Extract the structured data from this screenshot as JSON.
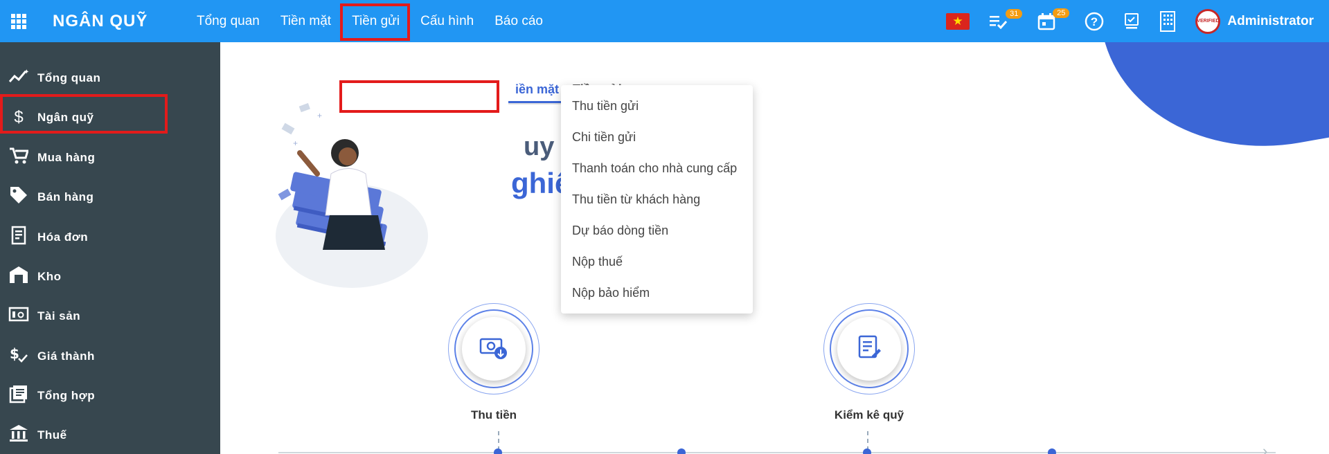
{
  "app": {
    "brand": "NGÂN QUỸ"
  },
  "nav": [
    {
      "label": "Tổng quan"
    },
    {
      "label": "Tiền mặt"
    },
    {
      "label": "Tiền gửi"
    },
    {
      "label": "Cấu hình"
    },
    {
      "label": "Báo cáo"
    }
  ],
  "header": {
    "tasks_badge": "31",
    "calendar_badge": "25",
    "user": "Administrator",
    "avatar_text": "VERIFIED"
  },
  "sidebar": {
    "items": [
      {
        "label": "Tổng quan",
        "icon": "chart-line-icon"
      },
      {
        "label": "Ngân quỹ",
        "icon": "dollar-icon"
      },
      {
        "label": "Mua hàng",
        "icon": "cart-icon"
      },
      {
        "label": "Bán hàng",
        "icon": "tag-icon"
      },
      {
        "label": "Hóa đơn",
        "icon": "invoice-icon"
      },
      {
        "label": "Kho",
        "icon": "warehouse-icon"
      },
      {
        "label": "Tài sản",
        "icon": "asset-icon"
      },
      {
        "label": "Giá thành",
        "icon": "cost-icon"
      },
      {
        "label": "Tổng hợp",
        "icon": "ledger-icon"
      },
      {
        "label": "Thuế",
        "icon": "bank-icon"
      }
    ]
  },
  "dropdown": {
    "items": [
      {
        "label": "Thu tiền gửi"
      },
      {
        "label": "Chi tiền gửi"
      },
      {
        "label": "Thanh toán cho nhà cung cấp"
      },
      {
        "label": "Thu tiền từ khách hàng"
      },
      {
        "label": "Dự báo dòng tiền"
      },
      {
        "label": "Nộp thuế"
      },
      {
        "label": "Nộp bảo hiểm"
      }
    ]
  },
  "main": {
    "tabs": [
      {
        "label": "iền mặt"
      },
      {
        "label": "Tiền gửi"
      }
    ],
    "title_line1": "uy trình",
    "title_line2": "ghiệp vụ tiền mặt",
    "steps": [
      {
        "label": "Thu tiền",
        "icon": "money-in-icon"
      },
      {
        "label": "Kiểm kê quỹ",
        "icon": "checklist-edit-icon"
      }
    ]
  },
  "colors": {
    "topbar": "#2196f3",
    "sidebar": "#37474f",
    "accent": "#3b66d6",
    "highlight": "#e31b1b",
    "badge": "#f39c12"
  }
}
